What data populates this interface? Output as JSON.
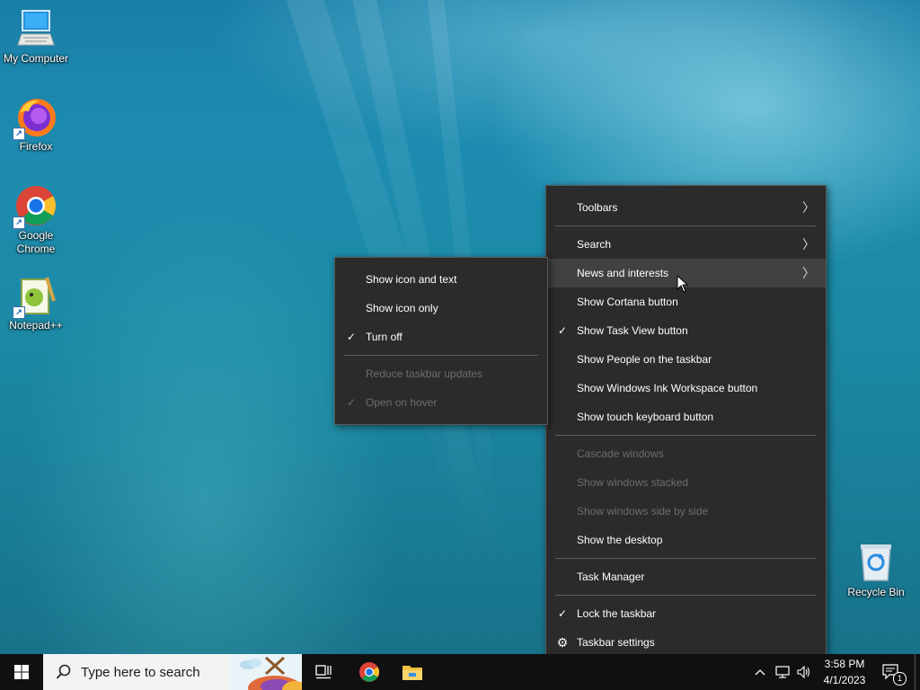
{
  "desktop": {
    "icons": [
      {
        "label": "My Computer"
      },
      {
        "label": "Firefox"
      },
      {
        "label": "Google Chrome"
      },
      {
        "label": "Notepad++"
      },
      {
        "label": "Recycle Bin"
      }
    ]
  },
  "taskbar_menu": {
    "items": [
      {
        "label": "Toolbars",
        "submenu": true
      },
      {
        "label": "Search",
        "submenu": true
      },
      {
        "label": "News and interests",
        "submenu": true,
        "highlighted": true
      },
      {
        "label": "Show Cortana button"
      },
      {
        "label": "Show Task View button",
        "checked": true
      },
      {
        "label": "Show People on the taskbar"
      },
      {
        "label": "Show Windows Ink Workspace button"
      },
      {
        "label": "Show touch keyboard button"
      },
      {
        "label": "Cascade windows",
        "disabled": true
      },
      {
        "label": "Show windows stacked",
        "disabled": true
      },
      {
        "label": "Show windows side by side",
        "disabled": true
      },
      {
        "label": "Show the desktop"
      },
      {
        "label": "Task Manager"
      },
      {
        "label": "Lock the taskbar",
        "checked": true
      },
      {
        "label": "Taskbar settings",
        "icon": "gear-icon"
      }
    ]
  },
  "news_submenu": {
    "items": [
      {
        "label": "Show icon and text"
      },
      {
        "label": "Show icon only"
      },
      {
        "label": "Turn off",
        "checked": true
      },
      {
        "label": "Reduce taskbar updates",
        "disabled": true
      },
      {
        "label": "Open on hover",
        "checked": true,
        "disabled": true
      }
    ]
  },
  "taskbar": {
    "search_placeholder": "Type here to search",
    "time": "3:58 PM",
    "date": "4/1/2023",
    "notification_count": "1",
    "apps": [
      "task-view-icon",
      "chrome-icon",
      "file-explorer-icon"
    ]
  },
  "colors": {
    "menu_bg": "#2b2b2b",
    "menu_hover": "#414141",
    "menu_disabled_text": "#6d6d6d",
    "taskbar_bg": "#101010"
  },
  "glyphs": {
    "check": "✓",
    "arrow": "〉",
    "gear": "⚙"
  }
}
